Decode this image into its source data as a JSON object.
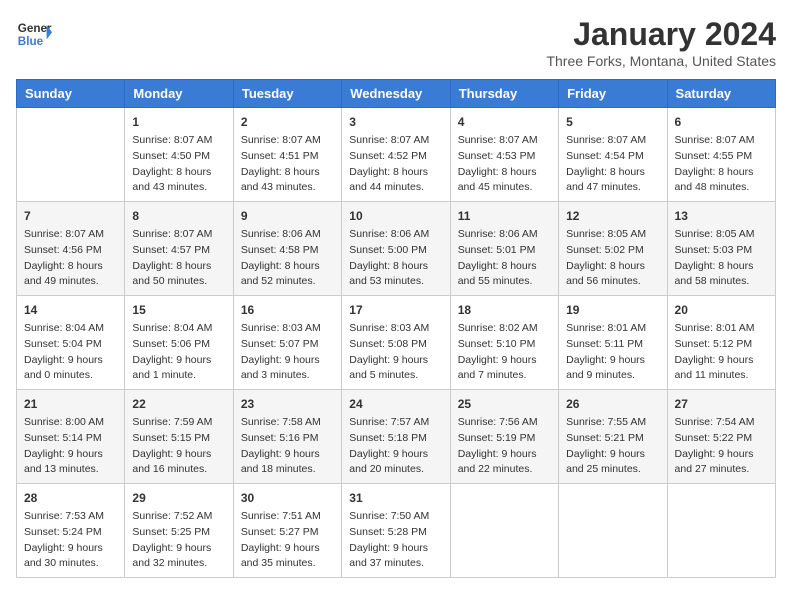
{
  "header": {
    "logo_line1": "General",
    "logo_line2": "Blue",
    "main_title": "January 2024",
    "subtitle": "Three Forks, Montana, United States"
  },
  "days_of_week": [
    "Sunday",
    "Monday",
    "Tuesday",
    "Wednesday",
    "Thursday",
    "Friday",
    "Saturday"
  ],
  "weeks": [
    [
      {
        "date": "",
        "info": ""
      },
      {
        "date": "1",
        "info": "Sunrise: 8:07 AM\nSunset: 4:50 PM\nDaylight: 8 hours\nand 43 minutes."
      },
      {
        "date": "2",
        "info": "Sunrise: 8:07 AM\nSunset: 4:51 PM\nDaylight: 8 hours\nand 43 minutes."
      },
      {
        "date": "3",
        "info": "Sunrise: 8:07 AM\nSunset: 4:52 PM\nDaylight: 8 hours\nand 44 minutes."
      },
      {
        "date": "4",
        "info": "Sunrise: 8:07 AM\nSunset: 4:53 PM\nDaylight: 8 hours\nand 45 minutes."
      },
      {
        "date": "5",
        "info": "Sunrise: 8:07 AM\nSunset: 4:54 PM\nDaylight: 8 hours\nand 47 minutes."
      },
      {
        "date": "6",
        "info": "Sunrise: 8:07 AM\nSunset: 4:55 PM\nDaylight: 8 hours\nand 48 minutes."
      }
    ],
    [
      {
        "date": "7",
        "info": "Sunrise: 8:07 AM\nSunset: 4:56 PM\nDaylight: 8 hours\nand 49 minutes."
      },
      {
        "date": "8",
        "info": "Sunrise: 8:07 AM\nSunset: 4:57 PM\nDaylight: 8 hours\nand 50 minutes."
      },
      {
        "date": "9",
        "info": "Sunrise: 8:06 AM\nSunset: 4:58 PM\nDaylight: 8 hours\nand 52 minutes."
      },
      {
        "date": "10",
        "info": "Sunrise: 8:06 AM\nSunset: 5:00 PM\nDaylight: 8 hours\nand 53 minutes."
      },
      {
        "date": "11",
        "info": "Sunrise: 8:06 AM\nSunset: 5:01 PM\nDaylight: 8 hours\nand 55 minutes."
      },
      {
        "date": "12",
        "info": "Sunrise: 8:05 AM\nSunset: 5:02 PM\nDaylight: 8 hours\nand 56 minutes."
      },
      {
        "date": "13",
        "info": "Sunrise: 8:05 AM\nSunset: 5:03 PM\nDaylight: 8 hours\nand 58 minutes."
      }
    ],
    [
      {
        "date": "14",
        "info": "Sunrise: 8:04 AM\nSunset: 5:04 PM\nDaylight: 9 hours\nand 0 minutes."
      },
      {
        "date": "15",
        "info": "Sunrise: 8:04 AM\nSunset: 5:06 PM\nDaylight: 9 hours\nand 1 minute."
      },
      {
        "date": "16",
        "info": "Sunrise: 8:03 AM\nSunset: 5:07 PM\nDaylight: 9 hours\nand 3 minutes."
      },
      {
        "date": "17",
        "info": "Sunrise: 8:03 AM\nSunset: 5:08 PM\nDaylight: 9 hours\nand 5 minutes."
      },
      {
        "date": "18",
        "info": "Sunrise: 8:02 AM\nSunset: 5:10 PM\nDaylight: 9 hours\nand 7 minutes."
      },
      {
        "date": "19",
        "info": "Sunrise: 8:01 AM\nSunset: 5:11 PM\nDaylight: 9 hours\nand 9 minutes."
      },
      {
        "date": "20",
        "info": "Sunrise: 8:01 AM\nSunset: 5:12 PM\nDaylight: 9 hours\nand 11 minutes."
      }
    ],
    [
      {
        "date": "21",
        "info": "Sunrise: 8:00 AM\nSunset: 5:14 PM\nDaylight: 9 hours\nand 13 minutes."
      },
      {
        "date": "22",
        "info": "Sunrise: 7:59 AM\nSunset: 5:15 PM\nDaylight: 9 hours\nand 16 minutes."
      },
      {
        "date": "23",
        "info": "Sunrise: 7:58 AM\nSunset: 5:16 PM\nDaylight: 9 hours\nand 18 minutes."
      },
      {
        "date": "24",
        "info": "Sunrise: 7:57 AM\nSunset: 5:18 PM\nDaylight: 9 hours\nand 20 minutes."
      },
      {
        "date": "25",
        "info": "Sunrise: 7:56 AM\nSunset: 5:19 PM\nDaylight: 9 hours\nand 22 minutes."
      },
      {
        "date": "26",
        "info": "Sunrise: 7:55 AM\nSunset: 5:21 PM\nDaylight: 9 hours\nand 25 minutes."
      },
      {
        "date": "27",
        "info": "Sunrise: 7:54 AM\nSunset: 5:22 PM\nDaylight: 9 hours\nand 27 minutes."
      }
    ],
    [
      {
        "date": "28",
        "info": "Sunrise: 7:53 AM\nSunset: 5:24 PM\nDaylight: 9 hours\nand 30 minutes."
      },
      {
        "date": "29",
        "info": "Sunrise: 7:52 AM\nSunset: 5:25 PM\nDaylight: 9 hours\nand 32 minutes."
      },
      {
        "date": "30",
        "info": "Sunrise: 7:51 AM\nSunset: 5:27 PM\nDaylight: 9 hours\nand 35 minutes."
      },
      {
        "date": "31",
        "info": "Sunrise: 7:50 AM\nSunset: 5:28 PM\nDaylight: 9 hours\nand 37 minutes."
      },
      {
        "date": "",
        "info": ""
      },
      {
        "date": "",
        "info": ""
      },
      {
        "date": "",
        "info": ""
      }
    ]
  ]
}
